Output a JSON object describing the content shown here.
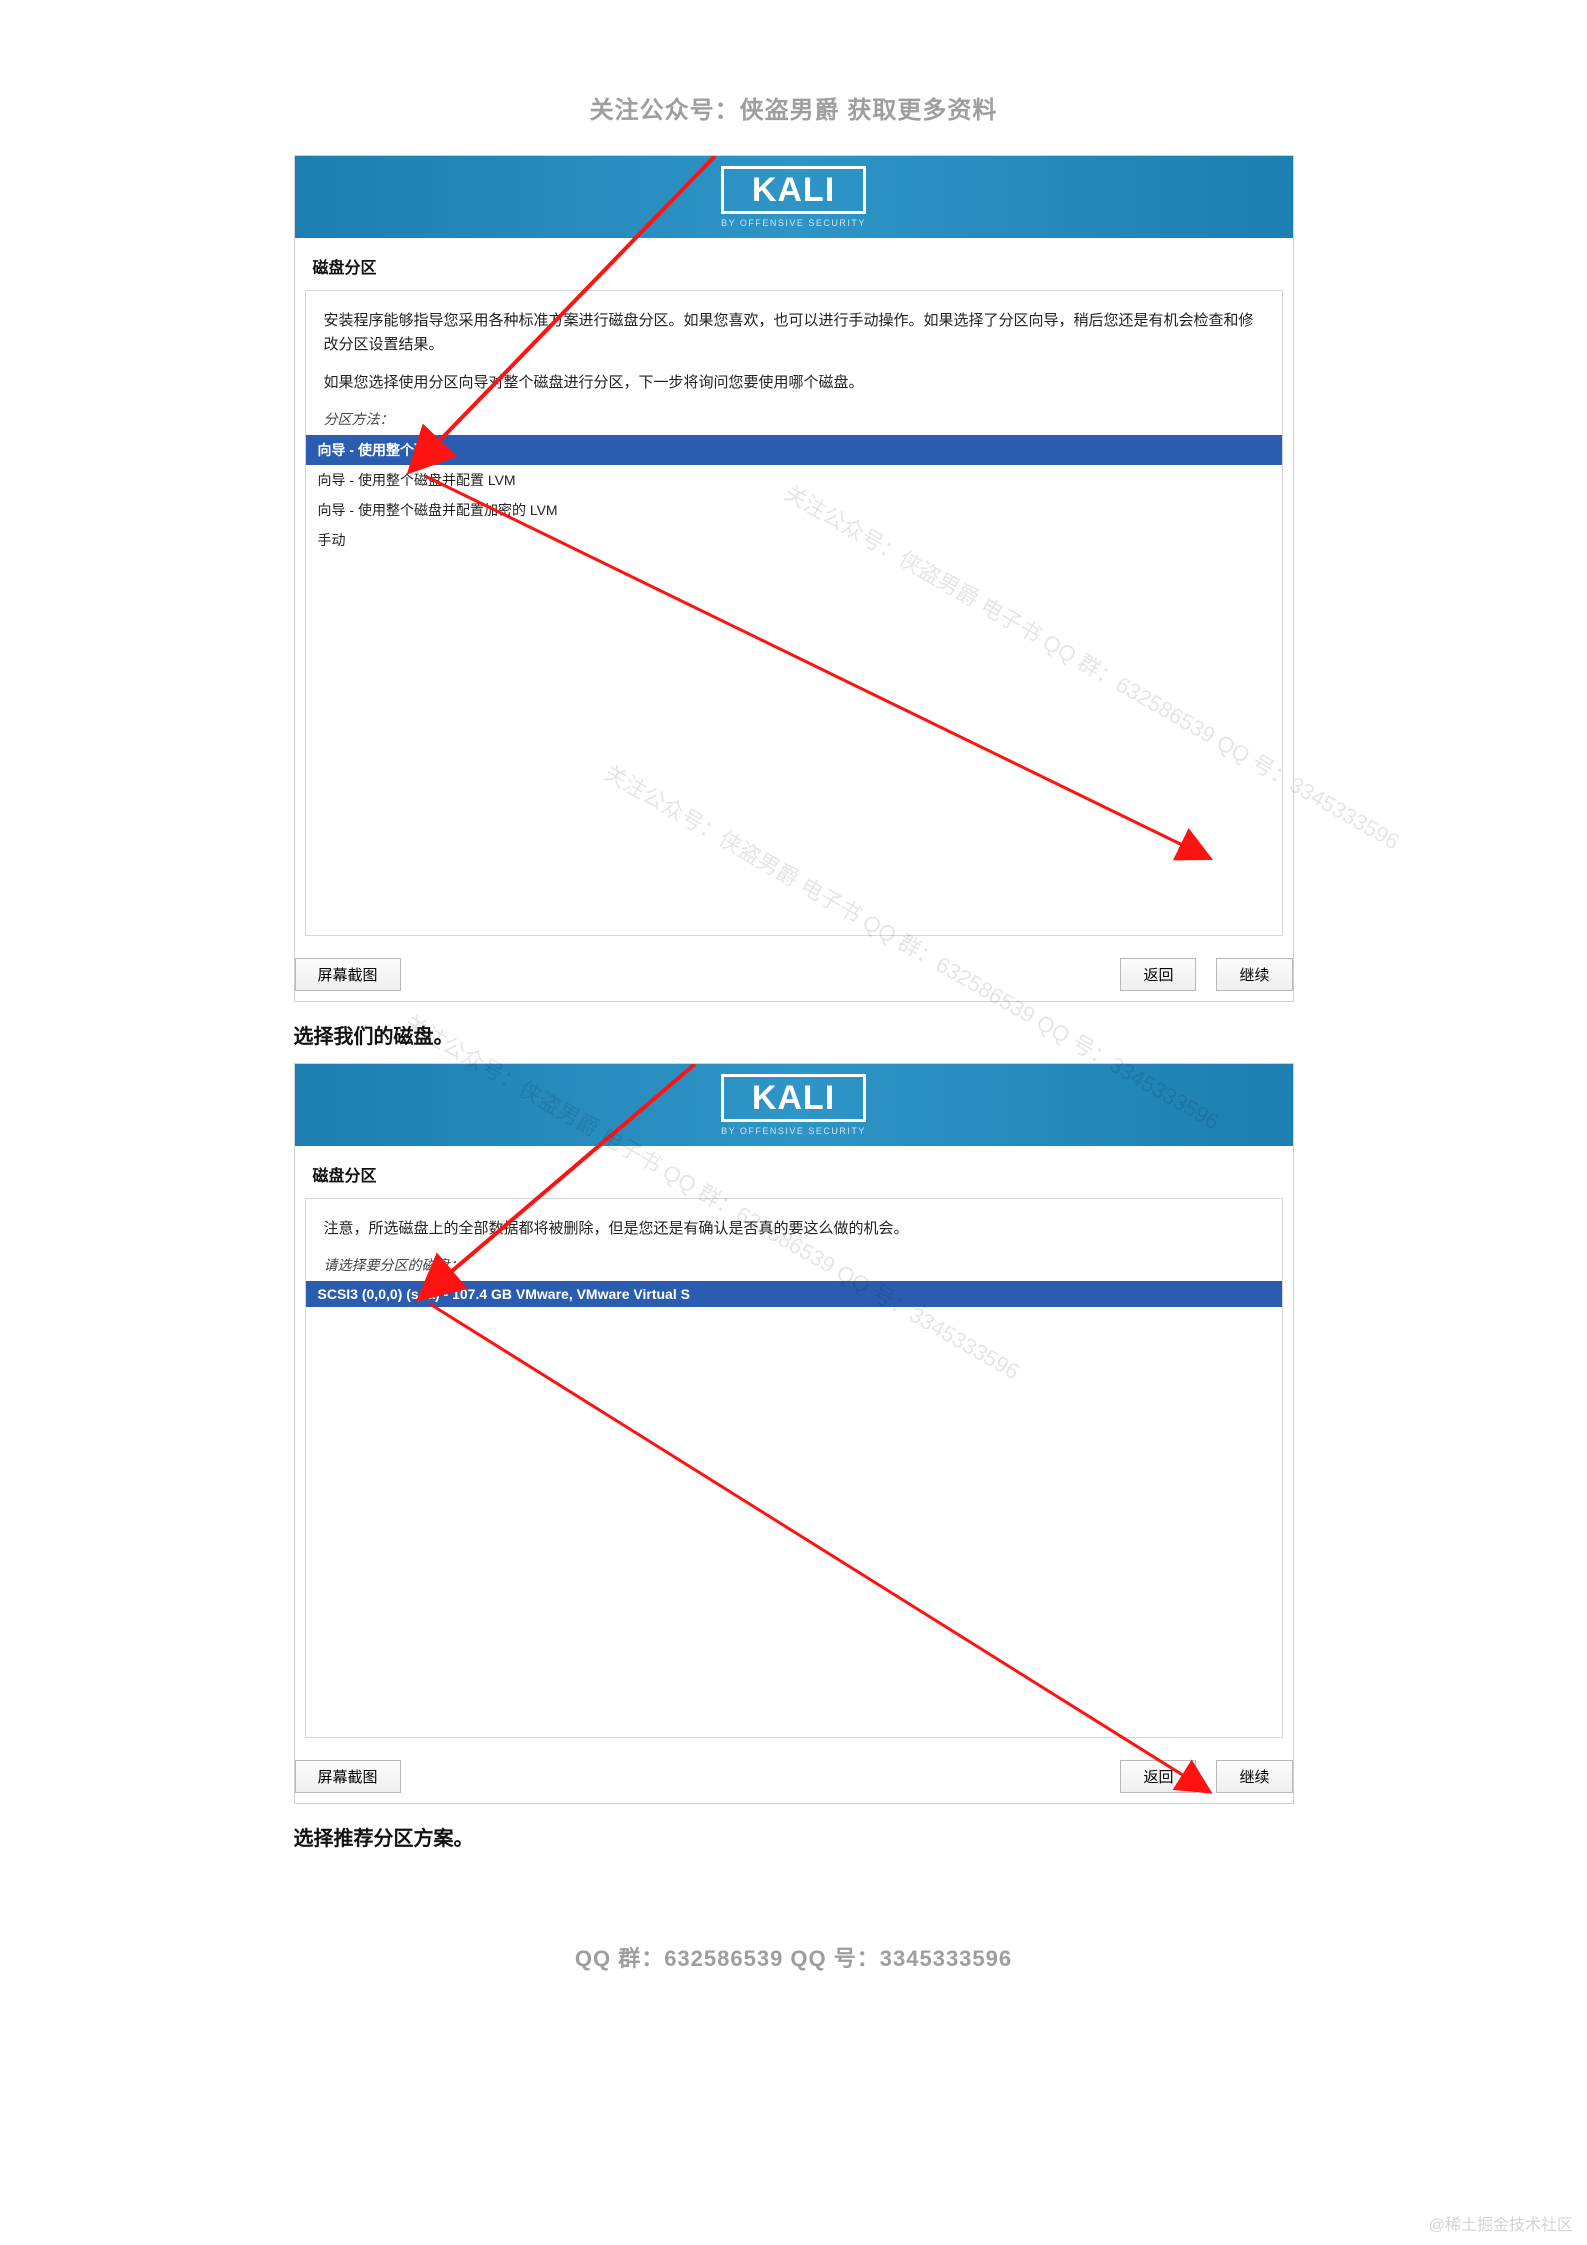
{
  "page_header": "关注公众号：侠盗男爵  获取更多资料",
  "kali": {
    "name": "KALI",
    "sub": "BY OFFENSIVE SECURITY"
  },
  "panel1": {
    "title": "磁盘分区",
    "msg1": "安装程序能够指导您采用各种标准方案进行磁盘分区。如果您喜欢，也可以进行手动操作。如果选择了分区向导，稍后您还是有机会检查和修改分区设置结果。",
    "msg2": "如果您选择使用分区向导对整个磁盘进行分区，下一步将询问您要使用哪个磁盘。",
    "method_label": "分区方法：",
    "options": [
      "向导 - 使用整个磁盘",
      "向导 - 使用整个磁盘并配置 LVM",
      "向导 - 使用整个磁盘并配置加密的 LVM",
      "手动"
    ],
    "selected_index": 0
  },
  "caption1": "选择我们的磁盘。",
  "panel2": {
    "title": "磁盘分区",
    "msg": "注意，所选磁盘上的全部数据都将被删除，但是您还是有确认是否真的要这么做的机会。",
    "method_label": "请选择要分区的磁盘：",
    "options": [
      "SCSI3 (0,0,0) (sda) - 107.4 GB VMware, VMware Virtual S"
    ],
    "selected_index": 0
  },
  "caption2": "选择推荐分区方案。",
  "buttons": {
    "screenshot": "屏幕截图",
    "back": "返回",
    "continue": "继续"
  },
  "footer": "QQ 群：632586539 QQ 号：3345333596",
  "watermark_diag": "关注公众号：侠盗男爵 电子书 QQ 群：632586539 QQ 号：3345333596",
  "corner_watermark": "@稀土掘金技术社区"
}
